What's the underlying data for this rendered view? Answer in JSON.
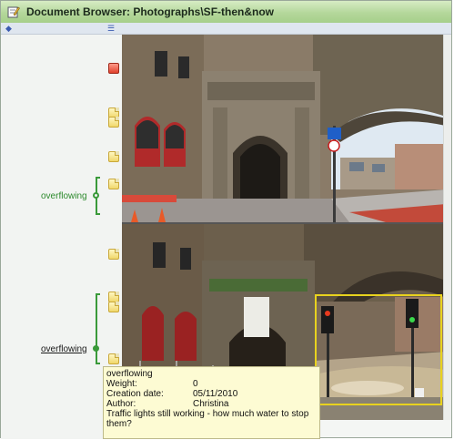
{
  "window": {
    "title": "Document Browser: Photographs\\SF-then&now",
    "title_icon": "pencil-document-icon"
  },
  "toolbar": {
    "left_icon": "diamond-icon",
    "mid_icon": "list-icon"
  },
  "annotations": {
    "bracket_label_1": "overflowing",
    "bracket_label_2": "overflowing",
    "marker_colors": {
      "note": "#f0d76a",
      "flag": "#e0412c"
    }
  },
  "tooltip": {
    "title": "overflowing",
    "fields": [
      {
        "key": "Weight:",
        "value": "0"
      },
      {
        "key": "Creation date:",
        "value": "05/11/2010"
      },
      {
        "key": "Author:",
        "value": "Christina"
      }
    ],
    "body": "Traffic lights still working - how much water to stop them?"
  },
  "colors": {
    "titlebar": "#b4d79b",
    "bracket": "#3a9a3a",
    "selection": "#e8d21e",
    "tooltip_bg": "#fdfbd3"
  }
}
